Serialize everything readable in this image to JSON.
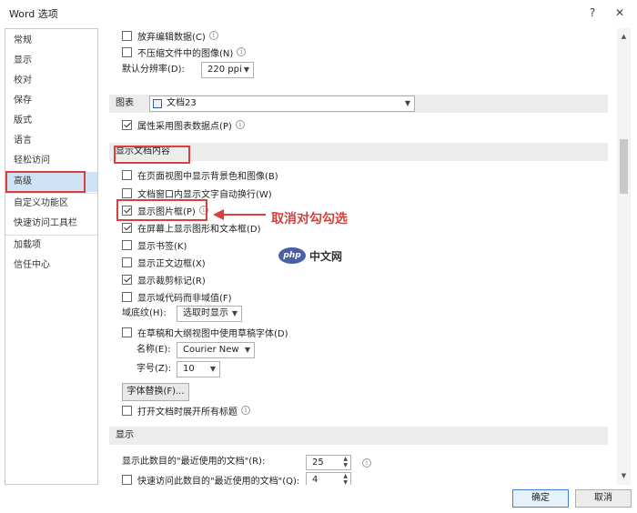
{
  "window": {
    "title": "Word 选项",
    "help": "?",
    "close": "✕"
  },
  "sidebar": {
    "items": [
      {
        "label": "常规"
      },
      {
        "label": "显示"
      },
      {
        "label": "校对"
      },
      {
        "label": "保存"
      },
      {
        "label": "版式"
      },
      {
        "label": "语言"
      },
      {
        "label": "轻松访问"
      },
      {
        "label": "高级",
        "selected": true
      },
      {
        "label": "自定义功能区"
      },
      {
        "label": "快速访问工具栏"
      },
      {
        "label": "加载项"
      },
      {
        "label": "信任中心"
      }
    ]
  },
  "image_section": {
    "discard_edit_data": "放弃编辑数据(C)",
    "no_compress": "不压缩文件中的图像(N)",
    "default_resolution_label": "默认分辨率(D):",
    "default_resolution_value": "220 ppi"
  },
  "chart_section": {
    "title": "图表",
    "document_value": "文档23",
    "property_follow": "属性采用图表数据点(P)"
  },
  "display_doc_section": {
    "title": "显示文档内容",
    "items": [
      {
        "label": "在页面视图中显示背景色和图像(B)",
        "checked": false
      },
      {
        "label": "文档窗口内显示文字自动换行(W)",
        "checked": false
      },
      {
        "label": "显示图片框(P)",
        "checked": true
      },
      {
        "label": "在屏幕上显示图形和文本框(D)",
        "checked": true
      },
      {
        "label": "显示书签(K)",
        "checked": false
      },
      {
        "label": "显示正文边框(X)",
        "checked": false
      },
      {
        "label": "显示裁剪标记(R)",
        "checked": true
      },
      {
        "label": "显示域代码而非域值(F)",
        "checked": false
      }
    ],
    "field_shading_label": "域底纹(H):",
    "field_shading_value": "选取时显示",
    "draft_font_label": "在草稿和大纲视图中使用草稿字体(D)",
    "name_label": "名称(E):",
    "name_value": "Courier New",
    "size_label": "字号(Z):",
    "size_value": "10",
    "font_substitution_button": "字体替换(F)...",
    "expand_headings": "打开文档时展开所有标题"
  },
  "display_section": {
    "title": "显示",
    "recent_docs_label": "显示此数目的\"最近使用的文档\"(R):",
    "recent_docs_value": "25",
    "quick_access_label": "快速访问此数目的\"最近使用的文档\"(Q):",
    "quick_access_value": "4"
  },
  "annotation": {
    "text": "取消对勾勾选",
    "color": "#d9403c"
  },
  "watermark": {
    "logo": "php",
    "text": "中文网"
  },
  "footer": {
    "ok": "确定",
    "cancel": "取消"
  },
  "colors": {
    "highlight": "#cfe3f7",
    "section_bg": "#ececec",
    "accent_red": "#d9403c"
  }
}
